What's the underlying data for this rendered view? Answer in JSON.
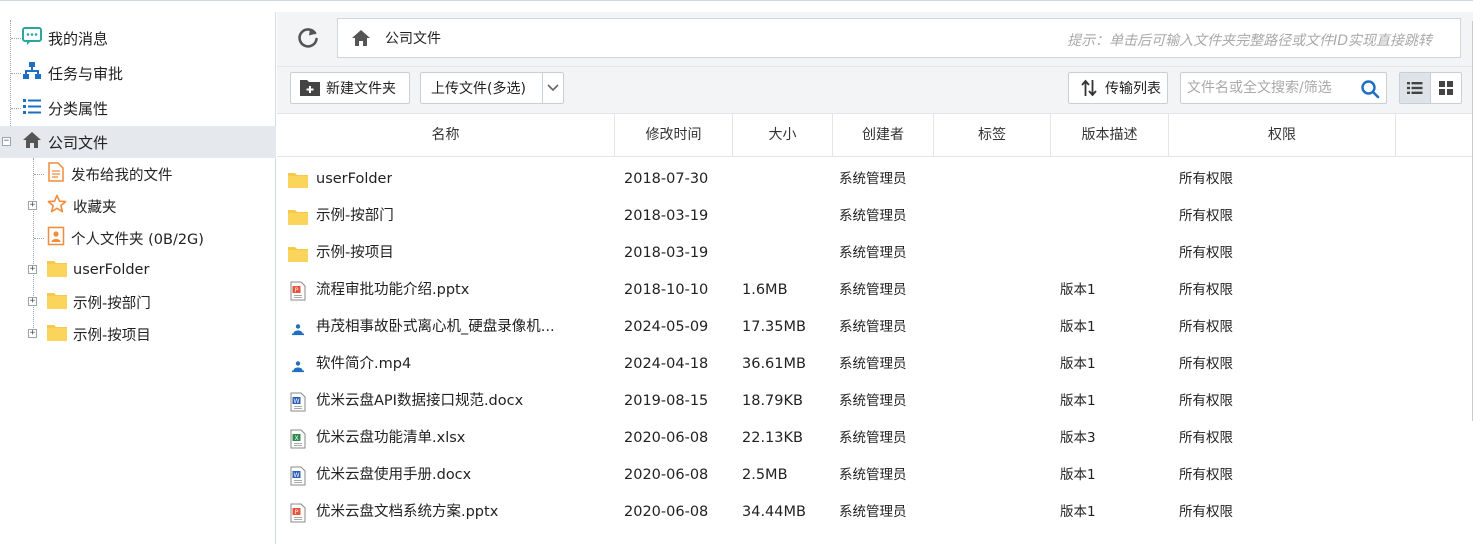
{
  "sidebar": {
    "top_items": [
      {
        "label": "我的消息",
        "icon": "message-icon"
      },
      {
        "label": "任务与审批",
        "icon": "org-tree-icon"
      },
      {
        "label": "分类属性",
        "icon": "list-icon"
      }
    ],
    "company": {
      "label": "公司文件",
      "icon": "home-icon",
      "expander": "−"
    },
    "children": [
      {
        "label": "发布给我的文件",
        "icon": "document-icon",
        "expander": ""
      },
      {
        "label": "收藏夹",
        "icon": "star-icon",
        "expander": "+"
      },
      {
        "label": "个人文件夹 (0B/2G)",
        "icon": "user-file-icon",
        "expander": ""
      },
      {
        "label": "userFolder",
        "icon": "folder-icon",
        "expander": "+"
      },
      {
        "label": "示例-按部门",
        "icon": "folder-icon",
        "expander": "+"
      },
      {
        "label": "示例-按项目",
        "icon": "folder-icon",
        "expander": "+"
      }
    ]
  },
  "pathbar": {
    "path": "公司文件",
    "hint": "提示：单击后可输入文件夹完整路径或文件ID实现直接跳转"
  },
  "toolbar": {
    "new_folder": "新建文件夹",
    "upload": "上传文件(多选)",
    "transfer": "传输列表",
    "search_placeholder": "文件名或全文搜索/筛选"
  },
  "table": {
    "headers": {
      "name": "名称",
      "modified": "修改时间",
      "size": "大小",
      "creator": "创建者",
      "tags": "标签",
      "version": "版本描述",
      "permission": "权限"
    },
    "rows": [
      {
        "icon": "folder-icon",
        "name": "userFolder",
        "modified": "2018-07-30",
        "size": "",
        "creator": "系统管理员",
        "tags": "",
        "version": "",
        "permission": "所有权限"
      },
      {
        "icon": "folder-icon",
        "name": "示例-按部门",
        "modified": "2018-03-19",
        "size": "",
        "creator": "系统管理员",
        "tags": "",
        "version": "",
        "permission": "所有权限"
      },
      {
        "icon": "folder-icon",
        "name": "示例-按项目",
        "modified": "2018-03-19",
        "size": "",
        "creator": "系统管理员",
        "tags": "",
        "version": "",
        "permission": "所有权限"
      },
      {
        "icon": "pptx-file-icon",
        "name": "流程审批功能介绍.pptx",
        "modified": "2018-10-10",
        "size": "1.6MB",
        "creator": "系统管理员",
        "tags": "",
        "version": "版本1",
        "permission": "所有权限"
      },
      {
        "icon": "video-file-icon",
        "name": "冉茂相事故卧式离心机_硬盘录像机...",
        "modified": "2024-05-09",
        "size": "17.35MB",
        "creator": "系统管理员",
        "tags": "",
        "version": "版本1",
        "permission": "所有权限"
      },
      {
        "icon": "video-file-icon",
        "name": "软件简介.mp4",
        "modified": "2024-04-18",
        "size": "36.61MB",
        "creator": "系统管理员",
        "tags": "",
        "version": "版本1",
        "permission": "所有权限"
      },
      {
        "icon": "docx-file-icon",
        "name": "优米云盘API数据接口规范.docx",
        "modified": "2019-08-15",
        "size": "18.79KB",
        "creator": "系统管理员",
        "tags": "",
        "version": "版本1",
        "permission": "所有权限"
      },
      {
        "icon": "xlsx-file-icon",
        "name": "优米云盘功能清单.xlsx",
        "modified": "2020-06-08",
        "size": "22.13KB",
        "creator": "系统管理员",
        "tags": "",
        "version": "版本3",
        "permission": "所有权限"
      },
      {
        "icon": "docx-file-icon",
        "name": "优米云盘使用手册.docx",
        "modified": "2020-06-08",
        "size": "2.5MB",
        "creator": "系统管理员",
        "tags": "",
        "version": "版本1",
        "permission": "所有权限"
      },
      {
        "icon": "pptx-file-icon",
        "name": "优米云盘文档系统方案.pptx",
        "modified": "2020-06-08",
        "size": "34.44MB",
        "creator": "系统管理员",
        "tags": "",
        "version": "版本1",
        "permission": "所有权限"
      }
    ]
  },
  "colors": {
    "accent_blue": "#1e6fc3",
    "folder_yellow": "#f7c948",
    "icon_gray": "#444444",
    "teal": "#2aa6a0"
  }
}
